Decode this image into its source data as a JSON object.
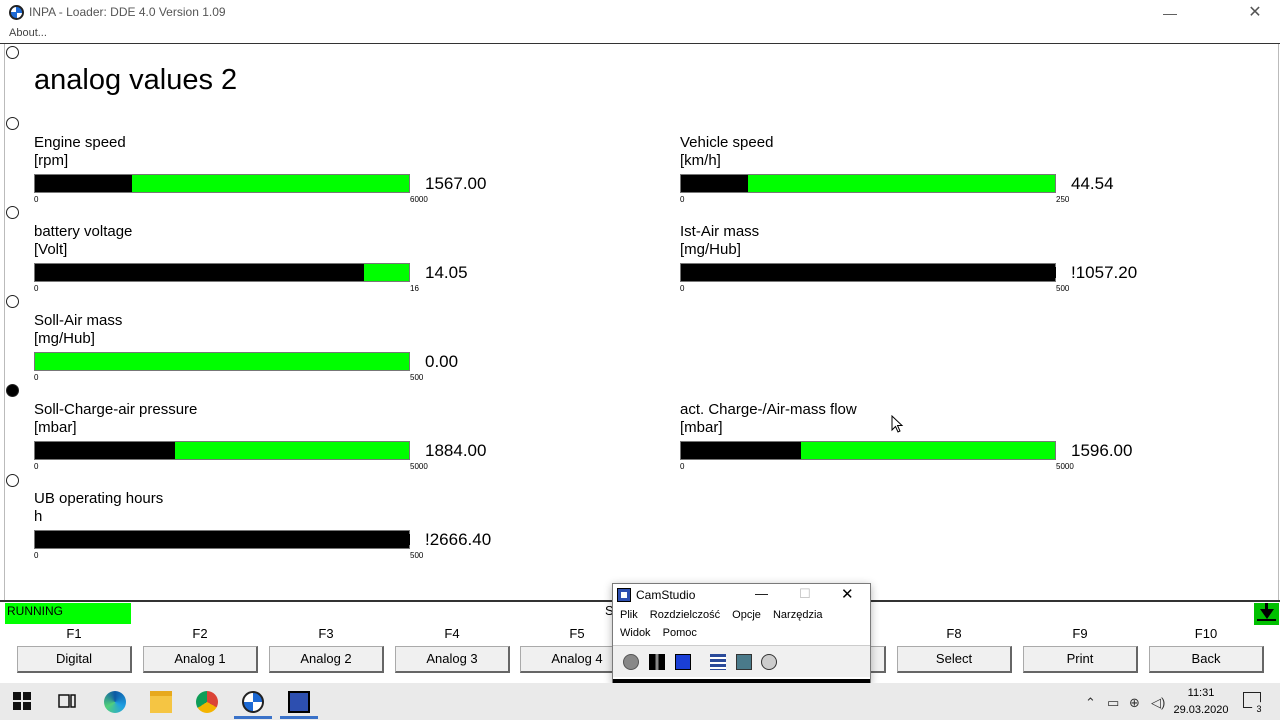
{
  "window": {
    "title": "INPA - Loader:  DDE 4.0 Version 1.09",
    "minimize_glyph": "—",
    "close_glyph": "✕"
  },
  "menu": {
    "about": "About..."
  },
  "page_title": "analog values 2",
  "gauges": [
    {
      "label": "Engine speed",
      "unit": "[rpm]",
      "value": "1567.00",
      "min": "0",
      "max": "6000",
      "level": 0.26
    },
    {
      "label": "Vehicle speed",
      "unit": "[km/h]",
      "value": "44.54",
      "min": "0",
      "max": "250",
      "level": 0.18
    },
    {
      "label": "battery voltage",
      "unit": "[Volt]",
      "value": "14.05",
      "min": "0",
      "max": "16",
      "level": 0.88
    },
    {
      "label": "Ist-Air mass",
      "unit": "[mg/Hub]",
      "value": "!1057.20",
      "min": "0",
      "max": "500",
      "level": 1.0
    },
    {
      "label": "Soll-Air mass",
      "unit": "[mg/Hub]",
      "value": "0.00",
      "min": "0",
      "max": "500",
      "level": 0.0
    },
    {
      "label": "Soll-Charge-air pressure",
      "unit": "[mbar]",
      "value": "1884.00",
      "min": "0",
      "max": "5000",
      "level": 0.375
    },
    {
      "label": "act. Charge-/Air-mass flow",
      "unit": "[mbar]",
      "value": "1596.00",
      "min": "0",
      "max": "5000",
      "level": 0.32
    },
    {
      "label": "UB operating hours",
      "unit": "h",
      "value": "!2666.40",
      "min": "0",
      "max": "500",
      "level": 1.0
    }
  ],
  "status": {
    "text": "RUNNING",
    "fragment": "S"
  },
  "fkeys": [
    {
      "key": "F1",
      "label": "Digital"
    },
    {
      "key": "F2",
      "label": "Analog 1"
    },
    {
      "key": "F3",
      "label": "Analog 2"
    },
    {
      "key": "F4",
      "label": "Analog 3"
    },
    {
      "key": "F5",
      "label": "Analog 4"
    },
    {
      "key": "F8",
      "label": "Select"
    },
    {
      "key": "F9",
      "label": "Print"
    },
    {
      "key": "F10",
      "label": "Back"
    }
  ],
  "camstudio": {
    "title": "CamStudio",
    "minimize_glyph": "—",
    "maximize_glyph": "☐",
    "close_glyph": "✕",
    "menu_row1": [
      "Plik",
      "Rozdzielczość",
      "Opcje",
      "Narzędzia"
    ],
    "menu_row2": [
      "Widok",
      "Pomoc"
    ]
  },
  "taskbar": {
    "time": "11:31",
    "date": "29.03.2020",
    "notification_count": "3"
  },
  "colors": {
    "bar_green": "#00ff00",
    "status_green": "#00ff00",
    "arrow_green": "#00c000",
    "camstudio_blue": "#2d4fb0"
  }
}
